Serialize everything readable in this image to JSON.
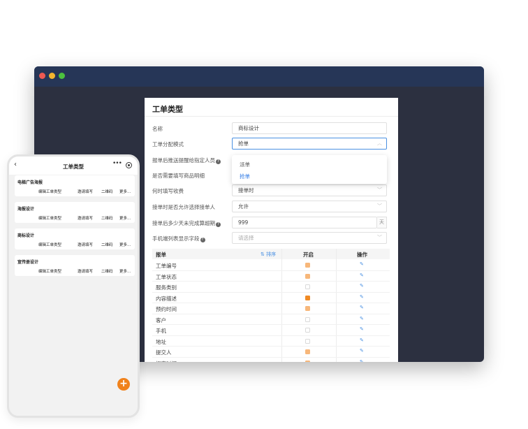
{
  "desktop": {
    "panel_title": "工单类型",
    "form": {
      "name_label": "名称",
      "name_value": "商标设计",
      "mode_label": "工单分配模式",
      "mode_value": "抢单",
      "mode_options": [
        "派单",
        "抢单"
      ],
      "remind_label": "报单后推送提醒给指定人员",
      "detail_label": "是否需要填写商品明细",
      "charge_label": "何时填写收费",
      "charge_value": "接单时",
      "allow_label": "接单时是否允许选择接单人",
      "allow_value": "允许",
      "overdue_label": "接单后多少天未完成算超期",
      "overdue_value": "999",
      "overdue_unit": "天",
      "mobile_label": "手机端列表显示字段",
      "mobile_placeholder": "请选择"
    },
    "table": {
      "headers": [
        "报单",
        "⇅ 排序",
        "开启",
        "操作"
      ],
      "rows": [
        {
          "name": "工单编号",
          "enabled": "partial"
        },
        {
          "name": "工单状态",
          "enabled": "partial"
        },
        {
          "name": "服务类别",
          "enabled": "off"
        },
        {
          "name": "内容描述",
          "enabled": "on"
        },
        {
          "name": "预约时间",
          "enabled": "partial"
        },
        {
          "name": "客户",
          "enabled": "off"
        },
        {
          "name": "手机",
          "enabled": "off"
        },
        {
          "name": "地址",
          "enabled": "off"
        },
        {
          "name": "提交人",
          "enabled": "partial"
        },
        {
          "name": "提交时间",
          "enabled": "partial"
        }
      ]
    }
  },
  "mobile": {
    "title": "工单类型",
    "more_icon": "•••",
    "cards": [
      {
        "title": "电梯广告海报",
        "actions": [
          "编辑工单类型",
          "邀请填写",
          "二维码",
          "更多..."
        ]
      },
      {
        "title": "海报设计",
        "actions": [
          "编辑工单类型",
          "邀请填写",
          "二维码",
          "更多..."
        ]
      },
      {
        "title": "商标设计",
        "actions": [
          "编辑工单类型",
          "邀请填写",
          "二维码",
          "更多..."
        ]
      },
      {
        "title": "宣传册设计",
        "actions": [
          "编辑工单类型",
          "邀请填写",
          "二维码",
          "更多..."
        ]
      }
    ],
    "fab_label": "+"
  },
  "colors": {
    "accent": "#2f7ae5",
    "orange": "#f0821c",
    "titlebar": "#263657",
    "window_bg": "#2c3040"
  }
}
